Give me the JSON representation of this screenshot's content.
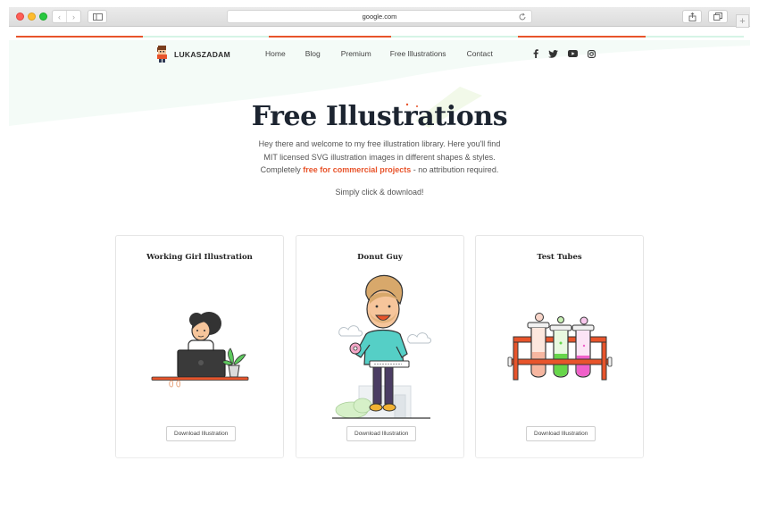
{
  "browser": {
    "url": "google.com",
    "back_glyph": "‹",
    "forward_glyph": "›",
    "new_tab_glyph": "+",
    "icons": [
      "sidebar-icon",
      "reload-icon",
      "share-icon",
      "tabs-icon"
    ]
  },
  "site": {
    "logo_text": "LUKASZADAM",
    "nav": [
      "Home",
      "Blog",
      "Premium",
      "Free Illustrations",
      "Contact"
    ],
    "social_icons": [
      "facebook-icon",
      "twitter-icon",
      "youtube-icon",
      "instagram-icon"
    ],
    "accent_color": "#e8542b",
    "mint_color": "#d6f4e6"
  },
  "hero": {
    "title": "Free Illustrations",
    "line1": "Hey there and welcome to my free illustration library. Here you'll find",
    "line2": "MIT licensed SVG illustration images in different shapes & styles.",
    "line3_before": "Completely ",
    "line3_highlight": "free for commercial projects",
    "line3_after": " - no attribution required.",
    "cta": "Simply click & download!"
  },
  "cards": [
    {
      "title": "Working Girl Illustration",
      "button": "Download Illustration"
    },
    {
      "title": "Donut Guy",
      "button": "Download Illustration"
    },
    {
      "title": "Test Tubes",
      "button": "Download Illustration"
    }
  ]
}
